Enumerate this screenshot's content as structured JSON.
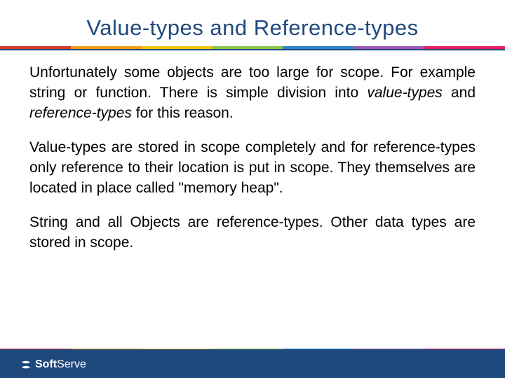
{
  "title": "Value-types and Reference-types",
  "paragraphs": {
    "p1a": "Unfortunately some objects are too large for scope. For example string or function. There is simple division into ",
    "p1_i1": "value-types",
    "p1b": " and ",
    "p1_i2": "reference-types",
    "p1c": " for this reason.",
    "p2": "Value-types are stored in scope completely and for reference-types only reference to their location is put in scope. They themselves are located in place called \"memory heap\".",
    "p3": "String and all Objects are reference-types. Other data types are stored in scope."
  },
  "footer": {
    "brand1": "Soft",
    "brand2": "Serve"
  }
}
